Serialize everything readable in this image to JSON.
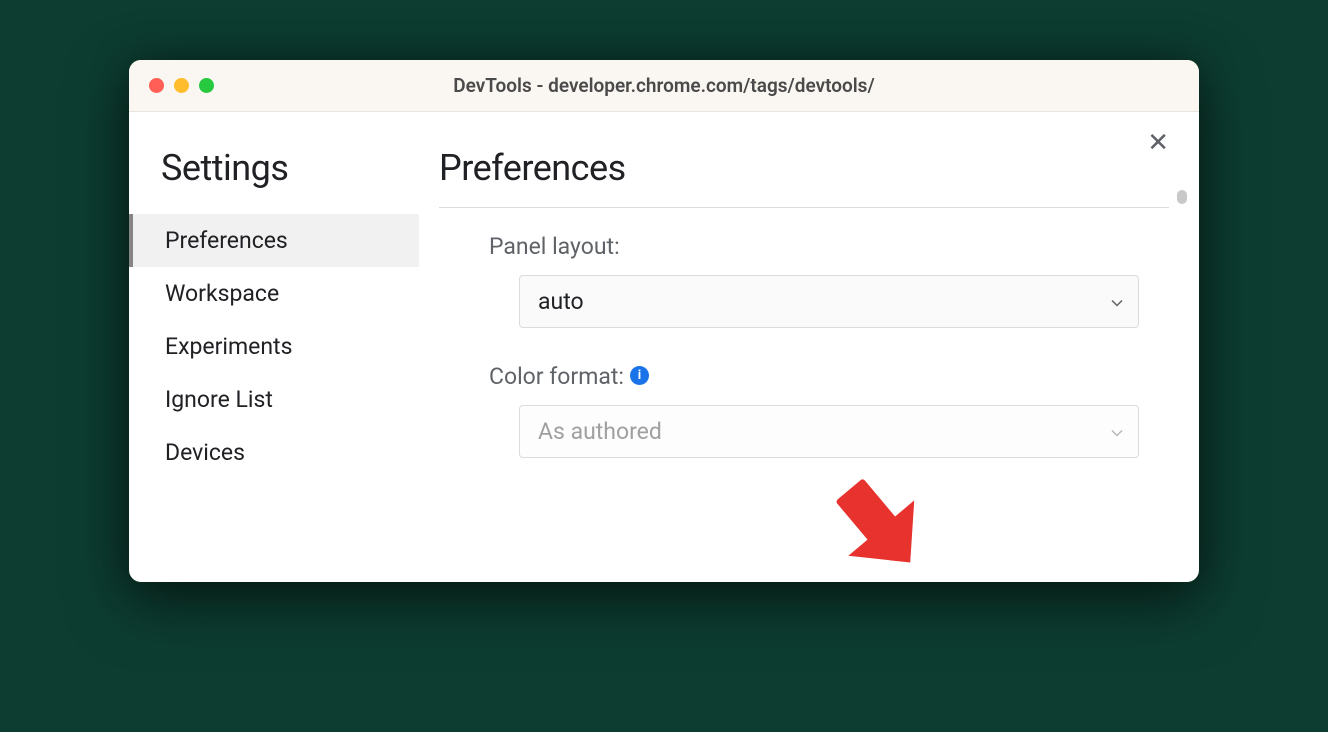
{
  "titlebar": {
    "title": "DevTools - developer.chrome.com/tags/devtools/"
  },
  "sidebar": {
    "heading": "Settings",
    "items": [
      {
        "label": "Preferences",
        "active": true
      },
      {
        "label": "Workspace",
        "active": false
      },
      {
        "label": "Experiments",
        "active": false
      },
      {
        "label": "Ignore List",
        "active": false
      },
      {
        "label": "Devices",
        "active": false
      }
    ]
  },
  "main": {
    "heading": "Preferences",
    "panel_layout": {
      "label": "Panel layout:",
      "value": "auto"
    },
    "color_format": {
      "label": "Color format:",
      "value": "As authored"
    }
  }
}
